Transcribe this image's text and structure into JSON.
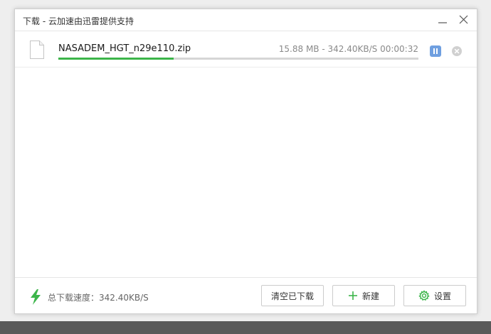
{
  "window": {
    "title": "下载 - 云加速由迅雷提供支持"
  },
  "downloads": [
    {
      "filename": "NASADEM_HGT_n29e110.zip",
      "size": "15.88 MB",
      "speed": "342.40KB/S",
      "time_remaining": "00:00:32",
      "progress": 0.32
    }
  ],
  "footer": {
    "total_speed_label": "总下载速度：342.40KB/S",
    "clear_button": "清空已下载",
    "new_button": "新建",
    "settings_button": "设置"
  },
  "colors": {
    "accent_green": "#3cb54a",
    "pause_blue": "#6f9fe0",
    "progress_track": "#d6d6d6"
  },
  "icons": {
    "file": "file-icon",
    "pause": "pause-icon",
    "cancel": "cancel-icon",
    "speed": "lightning-icon",
    "new": "plus-icon",
    "settings": "gear-icon",
    "minimize": "minimize-icon",
    "close": "close-icon"
  }
}
